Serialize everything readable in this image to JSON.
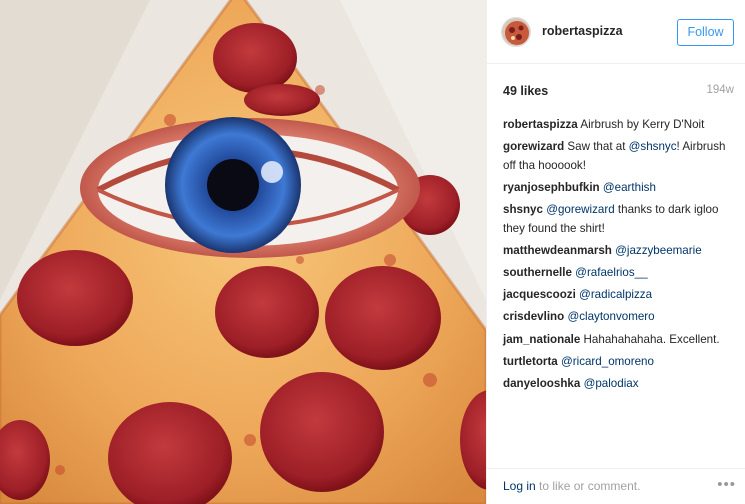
{
  "post": {
    "username": "robertaspizza",
    "follow_label": "Follow",
    "likes": "49 likes",
    "time": "194w"
  },
  "comments": [
    {
      "user": "robertaspizza",
      "text": " Airbrush by Kerry D'Noit",
      "mention": "",
      "after": ""
    },
    {
      "user": "gorewizard",
      "text": " Saw that at ",
      "mention": "@shsnyc",
      "after": "! Airbrush off tha hoooook!"
    },
    {
      "user": "ryanjosephbufkin",
      "text": " ",
      "mention": "@earthish",
      "after": ""
    },
    {
      "user": "shsnyc",
      "text": " ",
      "mention": "@gorewizard",
      "after": " thanks to dark igloo they found the shirt!"
    },
    {
      "user": "matthewdeanmarsh",
      "text": " ",
      "mention": "@jazzybeemarie",
      "after": ""
    },
    {
      "user": "southernelle",
      "text": " ",
      "mention": "@rafaelrios__",
      "after": ""
    },
    {
      "user": "jacquescoozi",
      "text": " ",
      "mention": "@radicalpizza",
      "after": ""
    },
    {
      "user": "crisdevlino",
      "text": " ",
      "mention": "@claytonvomero",
      "after": ""
    },
    {
      "user": "jam_nationale",
      "text": " Hahahahahaha. Excellent.",
      "mention": "",
      "after": ""
    },
    {
      "user": "turtletorta",
      "text": " ",
      "mention": "@ricard_omoreno",
      "after": ""
    },
    {
      "user": "danyelooshka",
      "text": " ",
      "mention": "@palodiax",
      "after": ""
    }
  ],
  "footer": {
    "login_link": "Log in",
    "login_text": " to like or comment.",
    "more_icon": "ellipsis-icon",
    "more_glyph": "•••"
  },
  "colors": {
    "accent": "#3897f0",
    "link": "#003569",
    "muted": "#a1a1a1"
  }
}
